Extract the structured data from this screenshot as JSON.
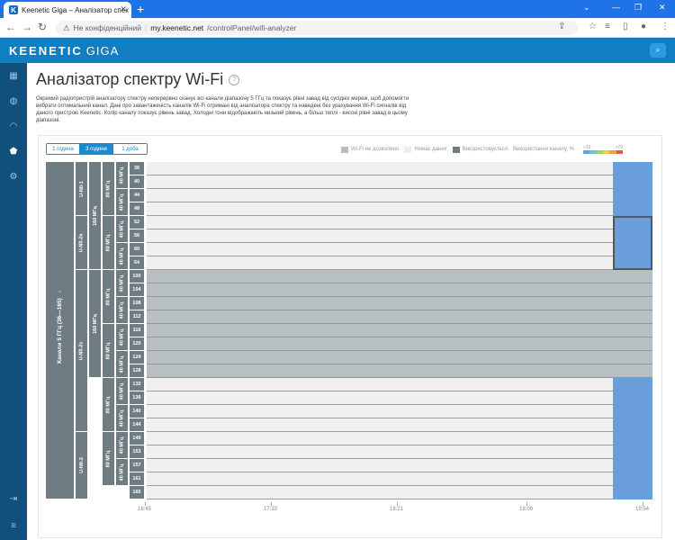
{
  "browser": {
    "tab_title": "Keenetic Giga – Аналізатор спек",
    "favicon": "K",
    "new_tab": "+",
    "not_secure": "Не конфіденційний",
    "url_host": "my.keenetic.net",
    "url_path": "/controlPanel/wifi-analyzer"
  },
  "header": {
    "logo": "KEENETIC",
    "logo_model": "GIGA"
  },
  "sidebar": {
    "icons": [
      "dashboard-icon",
      "globe-icon",
      "wifi-icon",
      "shield-icon",
      "gear-icon",
      "logout-icon",
      "menu-icon"
    ]
  },
  "page": {
    "title": "Аналізатор спектру Wi-Fi",
    "help": "?",
    "description": "Окремий радіопристрій аналізатору спектру неперервно сканує всі канали діапазону 5 ГГц та показує рівні завад від сусідніх мереж, щоб допомогти вибрати оптимальний канал. Дані про завантаженість каналів Wi-Fi отримані від аналізатора спектру та наведені без урахування Wi-Fi сигналів від даного пристрою Keenetic. Колір каналу показує рівень завад. Холодні тони відображають низький рівень, а більш теплі - високі рівні завад в цьому діапазоні."
  },
  "time_buttons": [
    {
      "label": "1 година",
      "selected": false
    },
    {
      "label": "3 години",
      "selected": true
    },
    {
      "label": "1 доба",
      "selected": false
    }
  ],
  "legend": {
    "not_allowed": "Wi-Fi не дозволено",
    "no_data": "Немає даних",
    "in_use": "Використовується",
    "usage": "Використання каналу, %",
    "scale_min": "<10",
    "scale_max": ">70",
    "colors": {
      "not_allowed": "#b7bfc3",
      "no_data": "#eeeeee",
      "in_use": "#6f7d83"
    }
  },
  "band": {
    "label": "Канали 5 ГГц (36—165)"
  },
  "unii_groups": [
    {
      "label": "U-NII-1",
      "rows": 4
    },
    {
      "label": "U-NII-2a",
      "rows": 4
    },
    {
      "label": "U-NII-2c",
      "rows": 12
    },
    {
      "label": "U-NII-3",
      "rows": 5
    }
  ],
  "channels": [
    "36",
    "40",
    "44",
    "48",
    "52",
    "56",
    "60",
    "64",
    "100",
    "104",
    "108",
    "112",
    "116",
    "120",
    "124",
    "128",
    "132",
    "136",
    "140",
    "144",
    "149",
    "153",
    "157",
    "161",
    "165"
  ],
  "disallowed_channels": [
    "100",
    "104",
    "108",
    "112",
    "116",
    "120",
    "124",
    "128"
  ],
  "time_axis": [
    "16:45",
    "17:33",
    "18:21",
    "19:09",
    "19:54"
  ],
  "width_labels": {
    "mhz160": "160 МГц",
    "mhz80": "80 МГц",
    "mhz40": "40 МГц"
  }
}
